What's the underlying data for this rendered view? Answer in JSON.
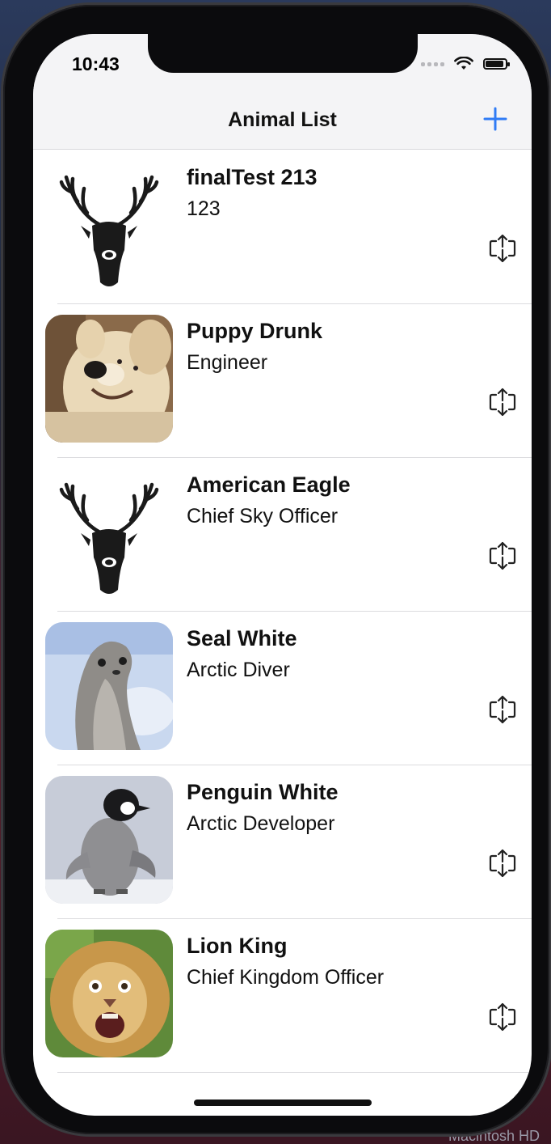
{
  "status": {
    "time": "10:43"
  },
  "navbar": {
    "title": "Animal List",
    "add_icon": "plus-icon"
  },
  "animals": [
    {
      "name": "finalTest 213",
      "subtitle": "123",
      "image": "deer-logo"
    },
    {
      "name": "Puppy Drunk",
      "subtitle": "Engineer",
      "image": "puppy-photo"
    },
    {
      "name": "American Eagle",
      "subtitle": "Chief Sky Officer",
      "image": "deer-logo"
    },
    {
      "name": "Seal White",
      "subtitle": "Arctic Diver",
      "image": "seal-photo"
    },
    {
      "name": "Penguin White",
      "subtitle": "Arctic Developer",
      "image": "penguin-photo"
    },
    {
      "name": "Lion King",
      "subtitle": "Chief Kingdom Officer",
      "image": "lion-photo"
    }
  ],
  "desktop": {
    "label": "Macintosh HD"
  },
  "colors": {
    "accent": "#2f7bf5",
    "text": "#111111",
    "separator": "#dcdcdf"
  }
}
